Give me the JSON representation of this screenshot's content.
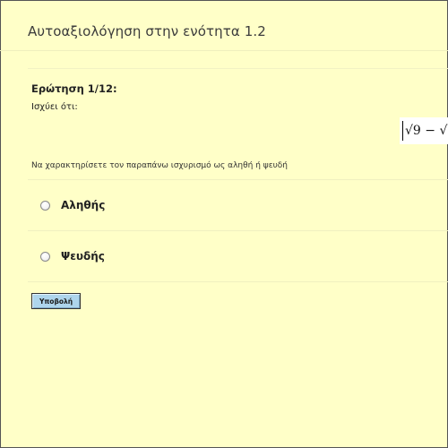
{
  "header": {
    "title": "Αυτοαξιολόγηση στην ενότητα 1.2"
  },
  "question": {
    "number_label": "Ερώτηση 1/12:",
    "stem": "Ισχύει ότι:",
    "formula_fragment": "√9 − √",
    "instruction": "Να χαρακτηρίσετε τον παραπάνω ισχυρισμό ως αληθή ή ψευδή"
  },
  "options": [
    {
      "label": "Αληθής",
      "selected": false
    },
    {
      "label": "Ψευδής",
      "selected": false
    }
  ],
  "actions": {
    "submit_label": "Υποβολή"
  },
  "colors": {
    "page_background": "#ffffc8",
    "button_background": "#aed5ec"
  }
}
